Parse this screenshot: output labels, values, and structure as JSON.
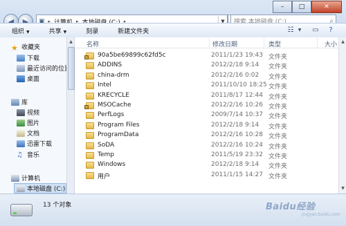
{
  "window": {
    "minimize_glyph": "–",
    "maximize_glyph": "□",
    "close_glyph": "✕"
  },
  "address": {
    "root_segment": "▸",
    "segments": [
      "计算机",
      "本地磁盘 (C:)"
    ],
    "search_placeholder": "搜索 本地磁盘 (C:)"
  },
  "toolbar": {
    "organize": "组织",
    "share": "共享",
    "burn": "刻录",
    "new_folder": "新建文件夹"
  },
  "nav": {
    "favorites": "收藏夹",
    "downloads": "下载",
    "recent": "最近访问的位置",
    "desktop": "桌面",
    "libraries": "库",
    "videos": "视频",
    "pictures": "图片",
    "documents": "文档",
    "xunlei": "迅雷下载",
    "music": "音乐",
    "computer": "计算机",
    "local_disk": "本地磁盘 (C:)"
  },
  "columns": {
    "name": "名称",
    "modified": "修改日期",
    "type": "类型",
    "size": "大小"
  },
  "files": [
    {
      "name": "90a5be69899c62fd5c",
      "date": "2011/1/23 19:43",
      "type": "文件夹",
      "locked": true
    },
    {
      "name": "ADDINS",
      "date": "2012/2/18 9:14",
      "type": "文件夹",
      "locked": false
    },
    {
      "name": "china-drm",
      "date": "2012/2/16 0:02",
      "type": "文件夹",
      "locked": false
    },
    {
      "name": "Intel",
      "date": "2011/10/10 18:25",
      "type": "文件夹",
      "locked": false
    },
    {
      "name": "KRECYCLE",
      "date": "2011/8/17 12:44",
      "type": "文件夹",
      "locked": false
    },
    {
      "name": "MSOCache",
      "date": "2012/2/16 10:26",
      "type": "文件夹",
      "locked": true
    },
    {
      "name": "PerfLogs",
      "date": "2009/7/14 10:37",
      "type": "文件夹",
      "locked": false
    },
    {
      "name": "Program Files",
      "date": "2012/2/18 9:14",
      "type": "文件夹",
      "locked": false
    },
    {
      "name": "ProgramData",
      "date": "2012/2/16 10:28",
      "type": "文件夹",
      "locked": false
    },
    {
      "name": "SoDA",
      "date": "2012/2/16 10:24",
      "type": "文件夹",
      "locked": false
    },
    {
      "name": "Temp",
      "date": "2011/5/19 23:32",
      "type": "文件夹",
      "locked": false
    },
    {
      "name": "Windows",
      "date": "2012/2/18 9:14",
      "type": "文件夹",
      "locked": false
    },
    {
      "name": "用户",
      "date": "2011/1/15 14:27",
      "type": "文件夹",
      "locked": false
    }
  ],
  "status": {
    "count": "13 个对象"
  },
  "watermark": {
    "text": "Baidu经验",
    "sub": "jingyan.baidu.com"
  }
}
